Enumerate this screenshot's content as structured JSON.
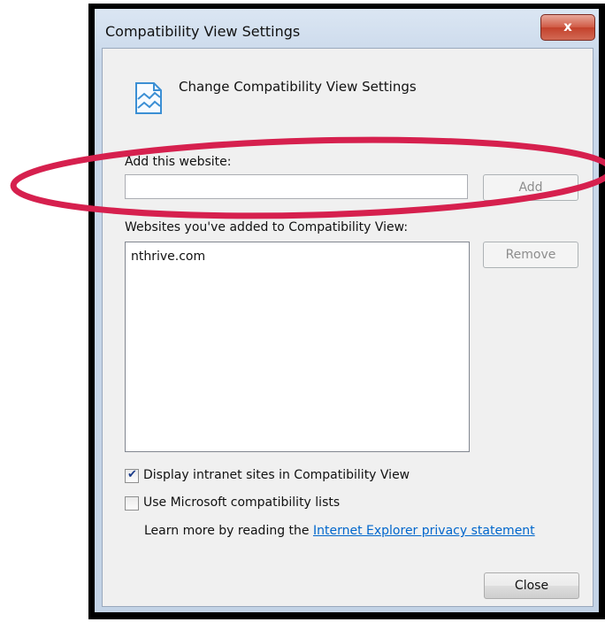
{
  "window": {
    "title": "Compatibility View Settings",
    "close_glyph": "x"
  },
  "dialog": {
    "heading": "Change Compatibility View Settings",
    "add_label": "Add this website:",
    "add_input_value": "",
    "add_button": "Add",
    "list_label": "Websites you've added to Compatibility View:",
    "sites": [
      "nthrive.com"
    ],
    "remove_button": "Remove",
    "intranet_checkbox": {
      "label": "Display intranet sites in Compatibility View",
      "checked": true
    },
    "ms_lists_checkbox": {
      "label": "Use Microsoft compatibility lists",
      "checked": false
    },
    "learn_more_text": "Learn more by reading the",
    "privacy_link": "Internet Explorer privacy statement",
    "close_button": "Close"
  },
  "colors": {
    "annotation_ellipse": "#d6204e",
    "link": "#0066cc",
    "title_close_button": "#c84a35"
  },
  "icons": [
    "compatibility-view-icon",
    "checkmark-icon"
  ]
}
